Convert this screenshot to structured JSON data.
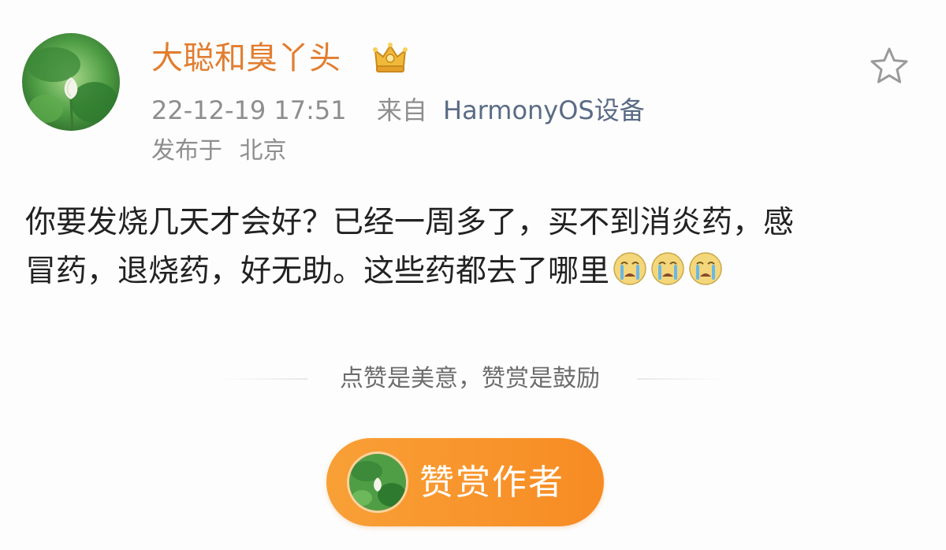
{
  "post": {
    "author_name": "大聪和臭丫头",
    "author_badge_icon": "crown-icon",
    "timestamp": "22-12-19 17:51",
    "source_label": "来自",
    "source_device": "HarmonyOS设备",
    "location_label": "发布于",
    "location": "北京",
    "body_line_1": "你要发烧几天才会好？已经一周多了，买不到消炎药，感",
    "body_line_2": "冒药，退烧药，好无助。这些药都去了哪里",
    "trailing_emojis": [
      "crying-face-icon",
      "crying-face-icon",
      "crying-face-icon"
    ]
  },
  "actions": {
    "favorite_icon": "star-icon"
  },
  "reward": {
    "note": "点赞是美意，赞赏是鼓励",
    "button_label": "赞赏作者"
  },
  "colors": {
    "author_name": "#e27d2f",
    "meta_text": "#8e8e8e",
    "device_link": "#5a6b84",
    "body_text": "#222222",
    "reward_button": "#f8962c",
    "reward_text": "#ffffff"
  }
}
